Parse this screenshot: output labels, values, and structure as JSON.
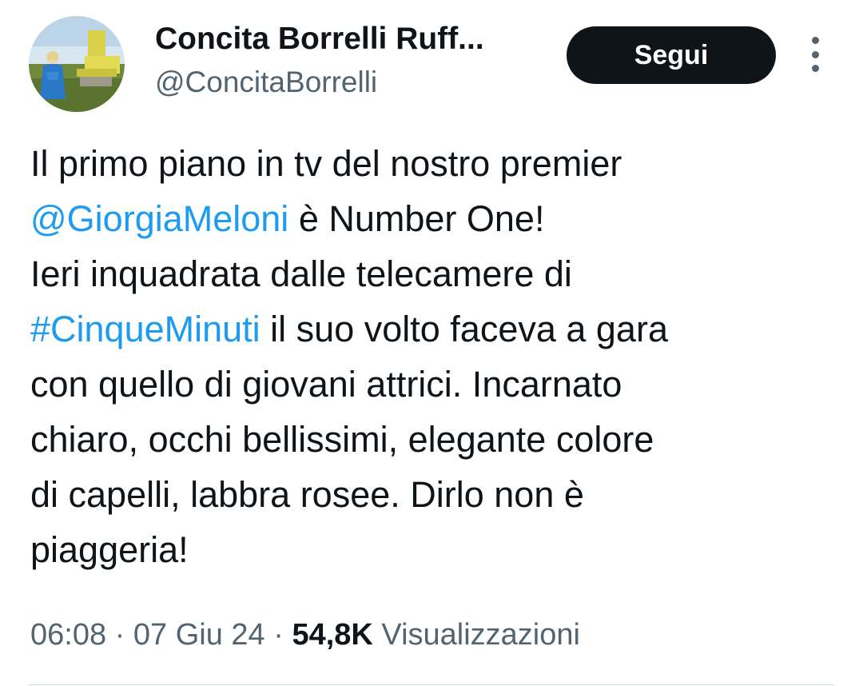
{
  "author": {
    "name": "Concita Borrelli Ruff...",
    "handle": "@ConcitaBorrelli"
  },
  "follow_label": "Segui",
  "more_icon": "more-vertical-icon",
  "tweet": {
    "segments": {
      "l1": "Il primo piano in tv del nostro premier",
      "mention": "@GiorgiaMeloni",
      "l2_rest": " è Number One!",
      "l3": "Ieri inquadrata dalle telecamere di",
      "hashtag": "#CinqueMinuti",
      "l4_rest": " il suo volto faceva a gara",
      "l5": "con quello di giovani attrici. Incarnato",
      "l6": "chiaro, occhi bellissimi, elegante colore",
      "l7": "di capelli, labbra rosee. Dirlo non è",
      "l8": "piaggeria!"
    }
  },
  "meta": {
    "time": "06:08",
    "separator": " · ",
    "date": "07 Giu 24",
    "views_count": "54,8K",
    "views_label": "Visualizzazioni"
  },
  "colors": {
    "link": "#1d9bf0",
    "text": "#0f1419",
    "secondary": "#536471",
    "button_bg": "#0f1419"
  }
}
